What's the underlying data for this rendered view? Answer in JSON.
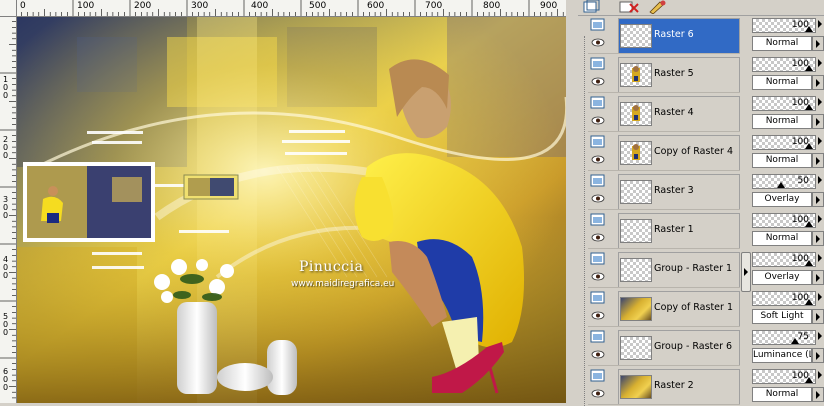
{
  "ruler": {
    "top_labels": [
      "0",
      "100",
      "200",
      "300",
      "400",
      "500",
      "600",
      "700",
      "800",
      "900"
    ],
    "left_labels": [
      "1 0 0",
      "2 0 0",
      "3 0 0",
      "4 0 0",
      "5 0 0",
      "6 0 0"
    ]
  },
  "canvas": {
    "watermark_name": "Pinuccia",
    "watermark_url": "www.maidiregrafica.eu"
  },
  "layers": [
    {
      "name": "Raster 6",
      "opacity": "100",
      "blend": "Normal",
      "selected": true,
      "thumb": "checker"
    },
    {
      "name": "Raster 5",
      "opacity": "100",
      "blend": "Normal",
      "selected": false,
      "thumb": "figure"
    },
    {
      "name": "Raster 4",
      "opacity": "100",
      "blend": "Normal",
      "selected": false,
      "thumb": "figure"
    },
    {
      "name": "Copy of Raster 4",
      "opacity": "100",
      "blend": "Normal",
      "selected": false,
      "thumb": "figure"
    },
    {
      "name": "Raster 3",
      "opacity": "50",
      "blend": "Overlay",
      "selected": false,
      "thumb": "checker"
    },
    {
      "name": "Raster 1",
      "opacity": "100",
      "blend": "Normal",
      "selected": false,
      "thumb": "checker"
    },
    {
      "name": "Group - Raster 1",
      "opacity": "100",
      "blend": "Overlay",
      "selected": false,
      "thumb": "checker"
    },
    {
      "name": "Copy of Raster 1",
      "opacity": "100",
      "blend": "Soft Light",
      "selected": false,
      "thumb": "yellow"
    },
    {
      "name": "Group - Raster 6",
      "opacity": "75",
      "blend": "Luminance (L)",
      "selected": false,
      "thumb": "checker"
    },
    {
      "name": "Raster 2",
      "opacity": "100",
      "blend": "Normal",
      "selected": false,
      "thumb": "yellow"
    }
  ],
  "colors": {
    "selected_row": "#316ac5",
    "panel_bg": "#d4d0c8"
  },
  "icons": {
    "toolbar": [
      "new-layer-icon",
      "delete-layer-icon",
      "edit-layer-icon"
    ],
    "row": [
      "layer-visibility-icon",
      "eye-icon"
    ]
  }
}
